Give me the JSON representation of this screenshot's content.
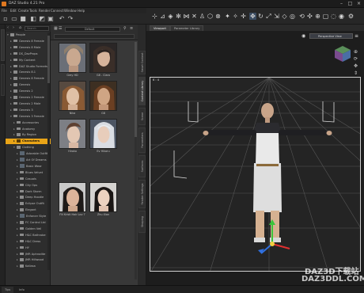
{
  "window": {
    "title": "DAZ Studio 4.21 Pro"
  },
  "menu": [
    "File",
    "Edit",
    "Create",
    "Tools",
    "Render",
    "Connect",
    "Window",
    "Help"
  ],
  "content_panel": {
    "search_placeholder": "Search",
    "category": "Default",
    "tiles": [
      {
        "label": "Grey HD"
      },
      {
        "label": "G8 - Clara"
      },
      {
        "label": "Nika"
      },
      {
        "label": "G8"
      },
      {
        "label": "Hiroko"
      },
      {
        "label": "Ev Hikaru"
      },
      {
        "label": "FN Kristi Hair Lov 7"
      },
      {
        "label": "Zhu Xian"
      }
    ]
  },
  "content_tree": {
    "nodes": [
      {
        "label": "People",
        "depth": 0,
        "icon": "folder",
        "open": true
      },
      {
        "label": "Genesis 8 Female",
        "depth": 1,
        "icon": "folder"
      },
      {
        "label": "Genesis 8 Male",
        "depth": 1,
        "icon": "folder"
      },
      {
        "label": "DS_DazProps",
        "depth": 1,
        "icon": "folder"
      },
      {
        "label": "My Content",
        "depth": 1,
        "icon": "folder"
      },
      {
        "label": "DAZ Studio Formats",
        "depth": 1,
        "icon": "folder"
      },
      {
        "label": "Genesis 8.1",
        "depth": 1,
        "icon": "folder"
      },
      {
        "label": "Genesis 8 Female",
        "depth": 1,
        "icon": "folder"
      },
      {
        "label": "Genesis",
        "depth": 1,
        "icon": "folder"
      },
      {
        "label": "Genesis 2",
        "depth": 1,
        "icon": "folder"
      },
      {
        "label": "Genesis 2 Female",
        "depth": 1,
        "icon": "folder"
      },
      {
        "label": "Genesis 2 Male",
        "depth": 1,
        "icon": "folder"
      },
      {
        "label": "Genesis 3",
        "depth": 1,
        "icon": "folder"
      },
      {
        "label": "Genesis 3 Female",
        "depth": 1,
        "icon": "folder",
        "open": true
      },
      {
        "label": "Accessories",
        "depth": 2,
        "icon": "folder"
      },
      {
        "label": "Anatomy",
        "depth": 2,
        "icon": "folder"
      },
      {
        "label": "By Region",
        "depth": 2,
        "icon": "folder"
      },
      {
        "label": "Characters",
        "depth": 2,
        "icon": "folder",
        "selected": true
      },
      {
        "label": "Clothing",
        "depth": 2,
        "icon": "folder",
        "open": true
      },
      {
        "label": "Adorable Outfit",
        "depth": 3,
        "icon": "thumb"
      },
      {
        "label": "Art Of Dreams",
        "depth": 3,
        "icon": "thumb"
      },
      {
        "label": "Basic Wear",
        "depth": 3,
        "icon": "thumb"
      },
      {
        "label": "Blues Velvet",
        "depth": 3,
        "icon": "folder"
      },
      {
        "label": "Casuals",
        "depth": 3,
        "icon": "folder"
      },
      {
        "label": "City Ops",
        "depth": 3,
        "icon": "folder"
      },
      {
        "label": "Dark Storm",
        "depth": 3,
        "icon": "folder"
      },
      {
        "label": "Deep Hoodie",
        "depth": 3,
        "icon": "folder"
      },
      {
        "label": "Eclipse Outfit",
        "depth": 3,
        "icon": "folder"
      },
      {
        "label": "Elegant",
        "depth": 3,
        "icon": "folder"
      },
      {
        "label": "Enforcer Style",
        "depth": 3,
        "icon": "thumb"
      },
      {
        "label": "FC Control Ltd",
        "depth": 3,
        "icon": "folder"
      },
      {
        "label": "Golden Veil",
        "depth": 3,
        "icon": "folder"
      },
      {
        "label": "H&C Bathrobe",
        "depth": 3,
        "icon": "folder"
      },
      {
        "label": "H&C Dress",
        "depth": 3,
        "icon": "folder"
      },
      {
        "label": "HY",
        "depth": 3,
        "icon": "folder"
      },
      {
        "label": "JMR Aphrodite",
        "depth": 3,
        "icon": "folder"
      },
      {
        "label": "JMR Hillwood",
        "depth": 3,
        "icon": "folder"
      },
      {
        "label": "Kallasa",
        "depth": 3,
        "icon": "folder"
      }
    ]
  },
  "side_tabs": [
    "Smart Content",
    "Content Library",
    "Scene",
    "Parameters",
    "Surfaces",
    "Render Settings",
    "Shaping"
  ],
  "viewport": {
    "tabs": [
      "Viewport",
      "Parameter Library"
    ],
    "camera": "Perspective View",
    "scene_label": "6 : 4"
  },
  "status": {
    "tabs": [
      "Tips",
      "Info"
    ]
  },
  "watermark": {
    "line1": "DAZ3D下载站",
    "line2": "DAZ3DDL.COM"
  },
  "colors": {
    "selection": "#e9a417",
    "accent": "#3b4c61"
  }
}
